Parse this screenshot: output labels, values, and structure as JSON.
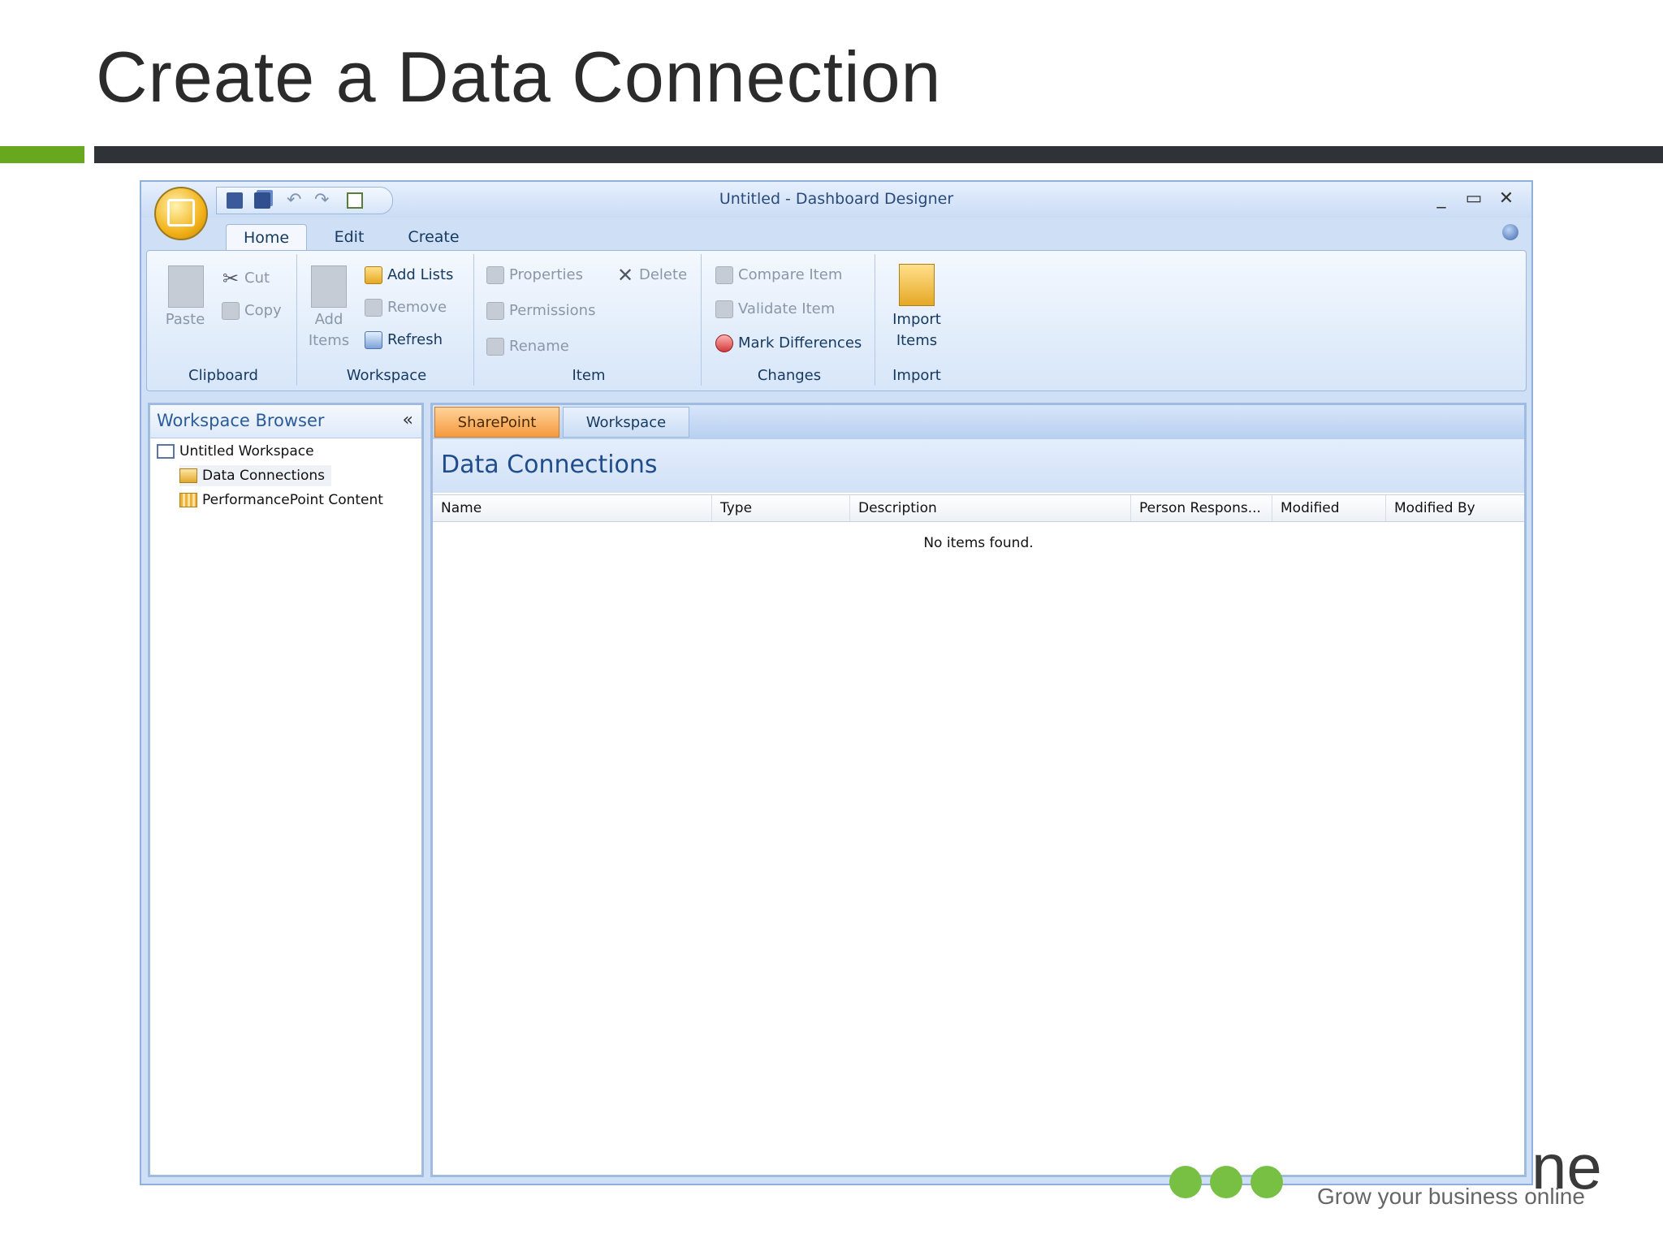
{
  "slide": {
    "title": "Create a Data Connection"
  },
  "window": {
    "title": "Untitled  -  Dashboard Designer",
    "controls": {
      "minimize": "_",
      "maximize": "▭",
      "close": "✕"
    }
  },
  "ribbon": {
    "tabs": [
      "Home",
      "Edit",
      "Create"
    ],
    "active_tab": "Home",
    "groups": {
      "clipboard": {
        "label": "Clipboard",
        "paste": "Paste",
        "cut": "Cut",
        "copy": "Copy"
      },
      "workspace": {
        "label": "Workspace",
        "add_items_1": "Add",
        "add_items_2": "Items",
        "add_lists": "Add Lists",
        "remove": "Remove",
        "refresh": "Refresh"
      },
      "item": {
        "label": "Item",
        "properties": "Properties",
        "delete": "Delete",
        "permissions": "Permissions",
        "rename": "Rename"
      },
      "changes": {
        "label": "Changes",
        "compare": "Compare Item",
        "validate": "Validate Item",
        "mark": "Mark Differences"
      },
      "import": {
        "label": "Import",
        "import_1": "Import",
        "import_2": "Items"
      }
    }
  },
  "workspace_browser": {
    "title": "Workspace Browser",
    "collapse": "«",
    "items": [
      {
        "label": "Untitled Workspace",
        "icon": "workspace-icon"
      },
      {
        "label": "Data Connections",
        "icon": "data-connections-icon"
      },
      {
        "label": "PerformancePoint Content",
        "icon": "content-icon"
      }
    ]
  },
  "main": {
    "tabs": [
      "SharePoint",
      "Workspace"
    ],
    "active_tab": "SharePoint",
    "header": "Data Connections",
    "columns": [
      "Name",
      "Type",
      "Description",
      "Person Respons...",
      "Modified",
      "Modified By"
    ],
    "empty_message": "No items found."
  },
  "logo": {
    "text": "ne",
    "tagline": "Grow your business online"
  },
  "colors": {
    "accent_green": "#67a81e",
    "dark_bar": "#2f3236",
    "sharepoint_tab": "#f59a3e"
  }
}
